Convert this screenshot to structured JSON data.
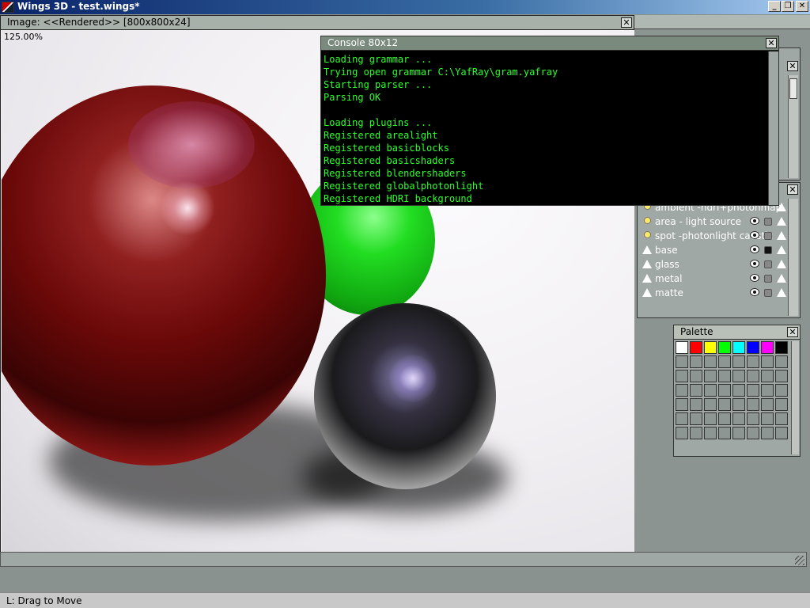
{
  "os": {
    "title": "Wings 3D - test.wings*",
    "min_glyph": "_",
    "max_glyph": "❐",
    "close_glyph": "✕"
  },
  "image_window": {
    "title": "Image: <<Rendered>> [800x800x24]",
    "zoom": "125.00%",
    "close_glyph": "✕"
  },
  "console": {
    "title": "Console 80x12",
    "close_glyph": "✕",
    "lines": [
      "Loading grammar ...",
      "Trying open grammar C:\\YafRay\\gram.yafray",
      "Starting parser ...",
      "Parsing OK",
      "",
      "Loading plugins ...",
      "Registered arealight",
      "Registered basicblocks",
      "Registered basicshaders",
      "Registered blendershaders",
      "Registered globalphotonlight",
      "Registered HDRI background"
    ]
  },
  "outliner": {
    "close_glyph": "✕",
    "rows": [
      {
        "label": "ambient -hdri+photonmap",
        "icon": "bulb",
        "lock": "none"
      },
      {
        "label": "area - light source",
        "icon": "bulb",
        "lock": "open"
      },
      {
        "label": "spot -photonlight caustic",
        "icon": "bulb",
        "lock": "open"
      },
      {
        "label": "base",
        "icon": "material",
        "lock": "locked"
      },
      {
        "label": "glass",
        "icon": "material",
        "lock": "open"
      },
      {
        "label": "metal",
        "icon": "material",
        "lock": "open"
      },
      {
        "label": "matte",
        "icon": "material",
        "lock": "open"
      }
    ]
  },
  "palette": {
    "title": "Palette",
    "close_glyph": "✕",
    "colors": [
      "#ffffff",
      "#ff0000",
      "#ffff00",
      "#00ff00",
      "#00ffff",
      "#0000ff",
      "#ff00ff",
      "#000000"
    ],
    "empty_rows": 6
  },
  "top_panel": {
    "close_glyph": "✕"
  },
  "status": {
    "text": "L: Drag to Move"
  },
  "scene_colors": {
    "red_sphere": "#b01010",
    "green_sphere": "#22dd22",
    "chrome_sphere": "#9a9a9a"
  }
}
